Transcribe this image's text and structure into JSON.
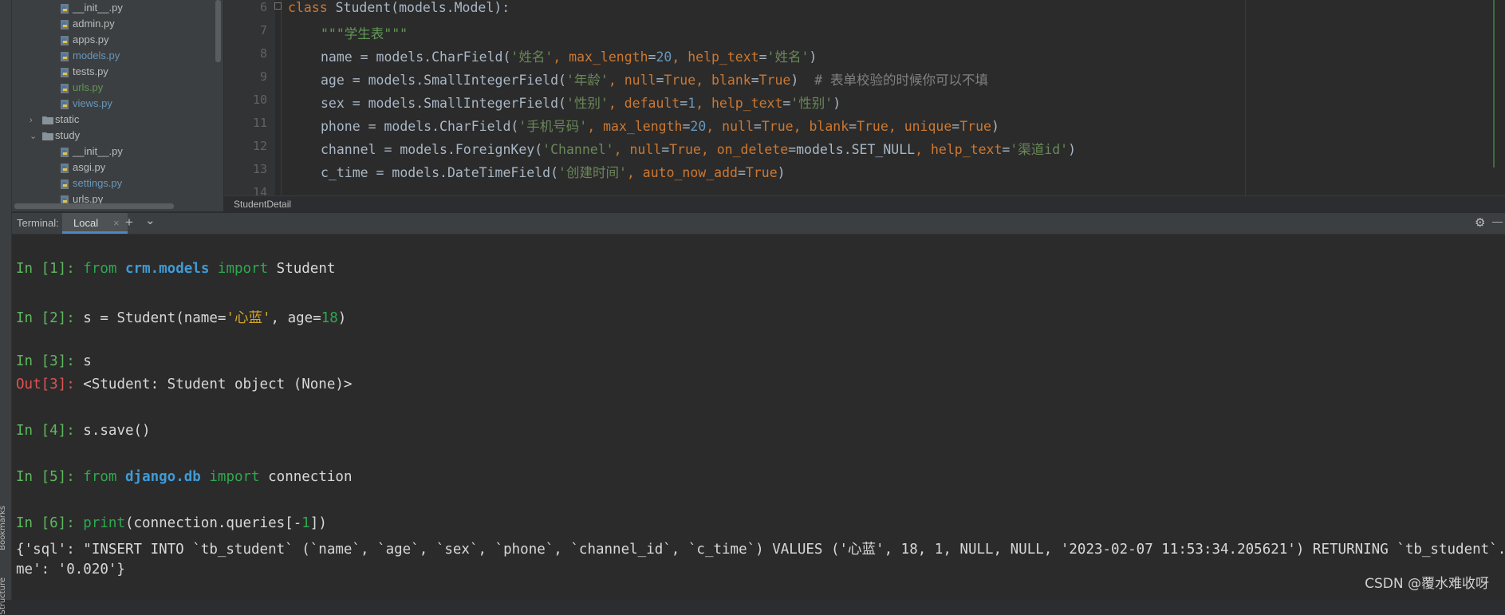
{
  "tool_strip": {
    "bookmarks_label": "Bookmarks",
    "structure_label": "Structure"
  },
  "project_tree": {
    "rows": [
      {
        "label": "__init__.py",
        "color": "default",
        "indent": 3
      },
      {
        "label": "admin.py",
        "color": "default",
        "indent": 3
      },
      {
        "label": "apps.py",
        "color": "default",
        "indent": 3
      },
      {
        "label": "models.py",
        "color": "blue",
        "indent": 3
      },
      {
        "label": "tests.py",
        "color": "default",
        "indent": 3
      },
      {
        "label": "urls.py",
        "color": "green",
        "indent": 3
      },
      {
        "label": "views.py",
        "color": "blue",
        "indent": 3
      },
      {
        "label": "static",
        "color": "default",
        "indent": 1,
        "folder": true,
        "expanded": false
      },
      {
        "label": "study",
        "color": "default",
        "indent": 1,
        "folder": true,
        "expanded": true
      },
      {
        "label": "__init__.py",
        "color": "default",
        "indent": 3
      },
      {
        "label": "asgi.py",
        "color": "default",
        "indent": 3
      },
      {
        "label": "settings.py",
        "color": "blue",
        "indent": 3
      },
      {
        "label": "urls.py",
        "color": "default",
        "indent": 3
      }
    ]
  },
  "editor": {
    "line_numbers": [
      "6",
      "7",
      "8",
      "9",
      "10",
      "11",
      "12",
      "13",
      "14"
    ],
    "lines": {
      "l6": {
        "kw": "class",
        "rest": " Student(models.Model):"
      },
      "l7": {
        "doc": "\"\"\"学生表\"\"\""
      },
      "l8": {
        "a": "name = models.CharField(",
        "s1": "'姓名'",
        "c1": ", ",
        "p1": "max_length",
        "e1": "=",
        "n1": "20",
        "c2": ", ",
        "p2": "help_text",
        "e2": "=",
        "s2": "'姓名'",
        "end": ")"
      },
      "l9": {
        "a": "age = models.SmallIntegerField(",
        "s1": "'年龄'",
        "c1": ", ",
        "p1": "null",
        "e1": "=",
        "v1": "True",
        "c2": ", ",
        "p2": "blank",
        "e2": "=",
        "v2": "True",
        "end": ")",
        "cmt": "  # 表单校验的时候你可以不填"
      },
      "l10": {
        "a": "sex = models.SmallIntegerField(",
        "s1": "'性别'",
        "c1": ", ",
        "p1": "default",
        "e1": "=",
        "n1": "1",
        "c2": ", ",
        "p2": "help_text",
        "e2": "=",
        "s2": "'性别'",
        "end": ")"
      },
      "l11": {
        "a": "phone = models.CharField(",
        "s1": "'手机号码'",
        "c1": ", ",
        "p1": "max_length",
        "e1": "=",
        "n1": "20",
        "c2": ", ",
        "p2": "null",
        "e2": "=",
        "v2": "True",
        "c3": ", ",
        "p3": "blank",
        "e3": "=",
        "v3": "True",
        "c4": ", ",
        "p4": "unique",
        "e4": "=",
        "v4": "True",
        "end": ")"
      },
      "l12": {
        "a": "channel = models.ForeignKey(",
        "s1": "'Channel'",
        "c1": ", ",
        "p1": "null",
        "e1": "=",
        "v1": "True",
        "c2": ", ",
        "p2": "on_delete",
        "e2": "=models.SET_NULL",
        "c3": ", ",
        "p3": "help_text",
        "e3": "=",
        "s3": "'渠道id'",
        "end": ")"
      },
      "l13": {
        "a": "c_time = models.DateTimeField(",
        "s1": "'创建时间'",
        "c1": ", ",
        "p1": "auto_now_add",
        "e1": "=",
        "v1": "True",
        "end": ")"
      }
    },
    "breadcrumb": "StudentDetail"
  },
  "terminal_bar": {
    "label": "Terminal:",
    "tab": "Local",
    "close": "×",
    "add": "+",
    "dropdown": "⌄",
    "settings": "⚙",
    "minimize": "—"
  },
  "terminal": {
    "lines": [
      {
        "prompt": "In [1]: ",
        "parts": [
          [
            "tkw",
            "from"
          ],
          [
            "plain",
            " "
          ],
          [
            "tmod",
            "crm.models"
          ],
          [
            "plain",
            " "
          ],
          [
            "tkw",
            "import"
          ],
          [
            "plain",
            " Student"
          ]
        ]
      },
      {
        "prompt": "In [2]: ",
        "parts": [
          [
            "plain",
            "s = Student(name="
          ],
          [
            "tstr",
            "'心蓝'"
          ],
          [
            "plain",
            ", age="
          ],
          [
            "tnum",
            "18"
          ],
          [
            "plain",
            ")"
          ]
        ]
      },
      {
        "prompt": "In [3]: ",
        "parts": [
          [
            "plain",
            "s"
          ]
        ]
      },
      {
        "prompt": "Out[3]: ",
        "out": true,
        "parts": [
          [
            "plain",
            "<Student: Student object (None)>"
          ]
        ]
      },
      {
        "prompt": "In [4]: ",
        "parts": [
          [
            "plain",
            "s.save()"
          ]
        ]
      },
      {
        "prompt": "In [5]: ",
        "parts": [
          [
            "tkw",
            "from"
          ],
          [
            "plain",
            " "
          ],
          [
            "tmod",
            "django.db"
          ],
          [
            "plain",
            " "
          ],
          [
            "tkw",
            "import"
          ],
          [
            "plain",
            " connection"
          ]
        ]
      },
      {
        "prompt": "In [6]: ",
        "parts": [
          [
            "tfn",
            "print"
          ],
          [
            "plain",
            "(connection.queries[-"
          ],
          [
            "tnum",
            "1"
          ],
          [
            "plain",
            "])"
          ]
        ]
      },
      {
        "prompt": "",
        "parts": [
          [
            "plain",
            "{'sql': \"INSERT INTO `tb_student` (`name`, `age`, `sex`, `phone`, `channel_id`, `c_time`) VALUES ('心蓝', 18, 1, NULL, NULL, '2023-02-07 11:53:34.205621') RETURNING `tb_student`.`id`\", '"
          ]
        ]
      },
      {
        "prompt": "",
        "parts": [
          [
            "plain",
            "me': '0.020'}"
          ]
        ]
      }
    ]
  },
  "watermark": "CSDN @覆水难收呀"
}
